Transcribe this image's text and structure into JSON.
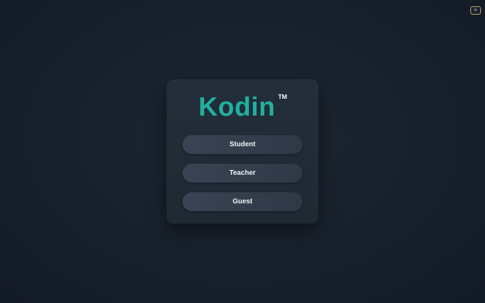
{
  "window": {
    "close_label": "×"
  },
  "logo": {
    "name": "Kodin",
    "trademark": "TM"
  },
  "roles": [
    {
      "label": "Student"
    },
    {
      "label": "Teacher"
    },
    {
      "label": "Guest"
    }
  ],
  "colors": {
    "accent": "#21b09e",
    "close_border": "#c8a46a",
    "background": "#18212d",
    "card": "#222d39",
    "button": "#364150"
  }
}
